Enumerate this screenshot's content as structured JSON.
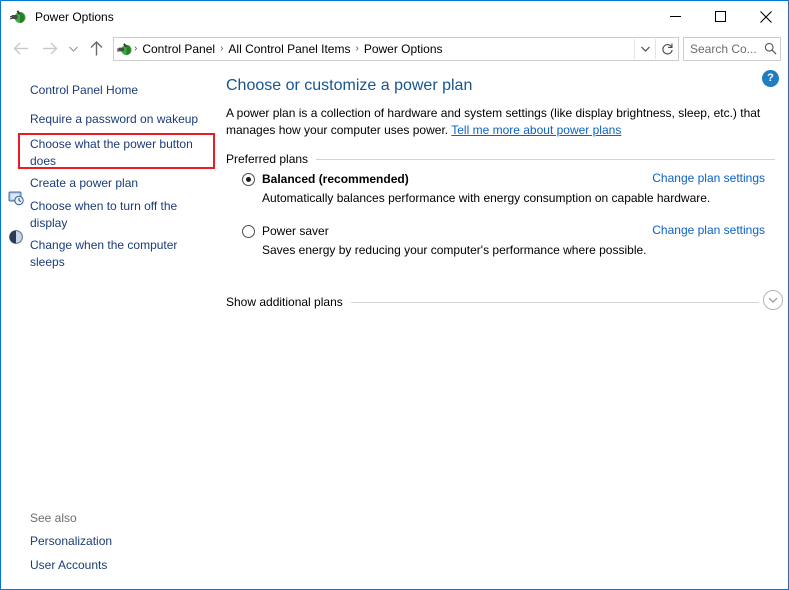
{
  "window": {
    "title": "Power Options",
    "title_icon": "power-plug-icon",
    "controls": {
      "minimize": "minimize-icon",
      "maximize": "maximize-icon",
      "close": "close-icon"
    }
  },
  "navbar": {
    "back": "back-arrow-icon",
    "forward": "forward-arrow-icon",
    "recent": "chevron-down-icon",
    "up": "up-arrow-icon",
    "address_icon": "power-plug-icon",
    "breadcrumbs": [
      "Control Panel",
      "All Control Panel Items",
      "Power Options"
    ],
    "separator": "›",
    "dropdown": "chevron-down-icon",
    "refresh": "refresh-icon",
    "search": {
      "placeholder": "Search Co...",
      "value": "",
      "icon": "search-icon"
    }
  },
  "help": {
    "label": "?",
    "icon": "help-icon"
  },
  "sidebar": {
    "items": [
      {
        "label": "Control Panel Home",
        "icon": null,
        "highlighted": false
      },
      {
        "label": "Require a password on wakeup",
        "icon": null,
        "highlighted": false
      },
      {
        "label": "Choose what the power button does",
        "icon": null,
        "highlighted": true
      },
      {
        "label": "Create a power plan",
        "icon": null,
        "highlighted": false
      },
      {
        "label": "Choose when to turn off the display",
        "icon": "monitor-clock-icon",
        "highlighted": false
      },
      {
        "label": "Change when the computer sleeps",
        "icon": "moon-sleep-icon",
        "highlighted": false
      }
    ],
    "see_also": {
      "label": "See also",
      "links": [
        "Personalization",
        "User Accounts"
      ]
    },
    "highlight_color": "#ed1c24"
  },
  "main": {
    "title": "Choose or customize a power plan",
    "description_part1": "A power plan is a collection of hardware and system settings (like display brightness, sleep, etc.) that manages how your computer uses power. ",
    "description_link": "Tell me more about power plans",
    "preferred_plans_label": "Preferred plans",
    "plans": [
      {
        "name": "Balanced (recommended)",
        "description": "Automatically balances performance with energy consumption on capable hardware.",
        "selected": true,
        "link": "Change plan settings"
      },
      {
        "name": "Power saver",
        "description": "Saves energy by reducing your computer's performance where possible.",
        "selected": false,
        "link": "Change plan settings"
      }
    ],
    "show_additional": {
      "label": "Show additional plans",
      "expand_icon": "chevron-down-icon"
    }
  },
  "colors": {
    "accent": "#0078d7",
    "link": "#0b62c8",
    "heading": "#16558f",
    "sidebar_link": "#1a3c7a",
    "highlight": "#ed1c24"
  }
}
